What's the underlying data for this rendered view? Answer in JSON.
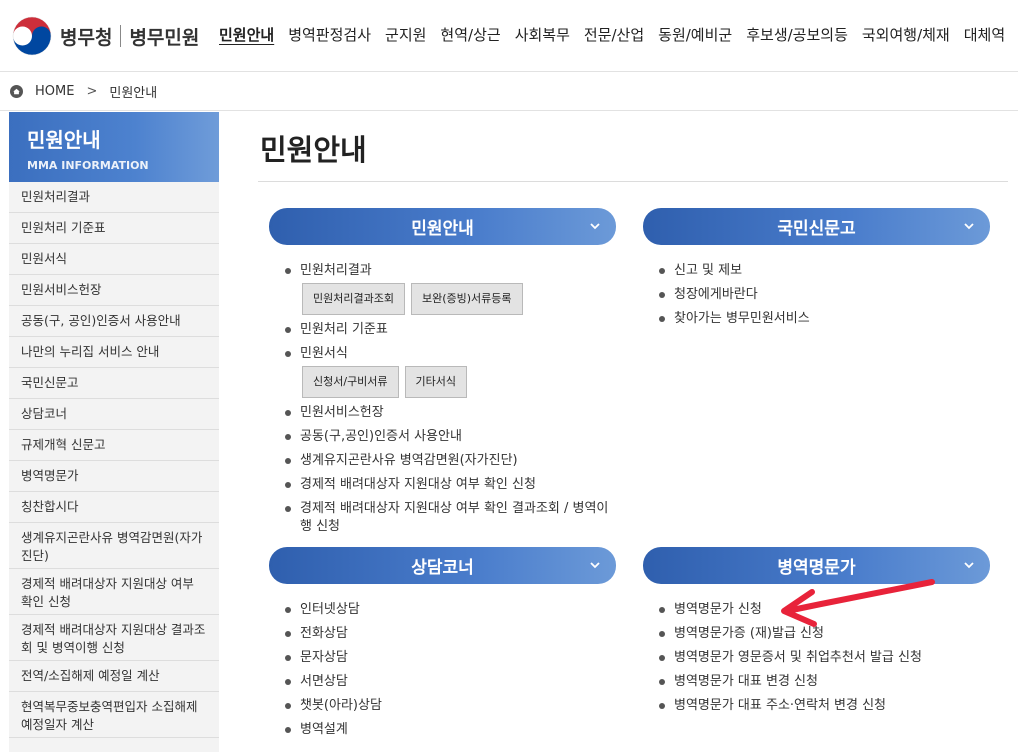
{
  "header": {
    "org_name": "병무청",
    "site_name": "병무민원",
    "nav": [
      "민원안내",
      "병역판정검사",
      "군지원",
      "현역/상근",
      "사회복무",
      "전문/산업",
      "동원/예비군",
      "후보생/공보의등",
      "국외여행/체재",
      "대체역"
    ],
    "active_nav": "민원안내"
  },
  "breadcrumb": {
    "home": "HOME",
    "separator": ">",
    "current": "민원안내"
  },
  "sidebar": {
    "title": "민원안내",
    "subtitle": "MMA INFORMATION",
    "items": [
      "민원처리결과",
      "민원처리 기준표",
      "민원서식",
      "민원서비스헌장",
      "공동(구, 공인)인증서 사용안내",
      "나만의 누리집 서비스 안내",
      "국민신문고",
      "상담코너",
      "규제개혁 신문고",
      "병역명문가",
      "칭찬합시다",
      "생계유지곤란사유 병역감면원(자가진단)",
      "경제적 배려대상자 지원대상 여부 확인 신청",
      "경제적 배려대상자 지원대상 결과조회 및 병역이행 신청",
      "전역/소집해제 예정일 계산",
      "현역복무중보충역편입자 소집해제 예정일자 계산"
    ]
  },
  "main": {
    "title": "민원안내",
    "cards": {
      "info": {
        "title": "민원안내",
        "items": [
          "민원처리결과",
          "민원처리 기준표",
          "민원서식",
          "민원서비스헌장",
          "공동(구,공인)인증서 사용안내",
          "생계유지곤란사유 병역감면원(자가진단)",
          "경제적 배려대상자 지원대상 여부 확인 신청",
          "경제적 배려대상자 지원대상 여부 확인 결과조회 / 병역이행 신청"
        ],
        "buttons_result": [
          "민원처리결과조회",
          "보완(증빙)서류등록"
        ],
        "buttons_forms": [
          "신청서/구비서류",
          "기타서식"
        ]
      },
      "sinmungo": {
        "title": "국민신문고",
        "items": [
          "신고 및 제보",
          "청장에게바란다",
          "찾아가는 병무민원서비스"
        ]
      },
      "counsel": {
        "title": "상담코너",
        "items": [
          "인터넷상담",
          "전화상담",
          "문자상담",
          "서면상담",
          "챗봇(아라)상담",
          "병역설계"
        ]
      },
      "family": {
        "title": "병역명문가",
        "items": [
          "병역명문가 신청",
          "병역명문가증 (재)발급 신청",
          "병역명문가 영문증서 및 취업추천서 발급 신청",
          "병역명문가 대표 변경 신청",
          "병역명문가 대표 주소·연락처 변경 신청"
        ]
      }
    }
  },
  "icons": [
    "taegeuk-logo-icon",
    "home-icon",
    "chevron-down-icon",
    "red-arrow-icon"
  ],
  "colors": {
    "accent_blue": "#3b6fbf",
    "arrow_red": "#e8233a"
  }
}
